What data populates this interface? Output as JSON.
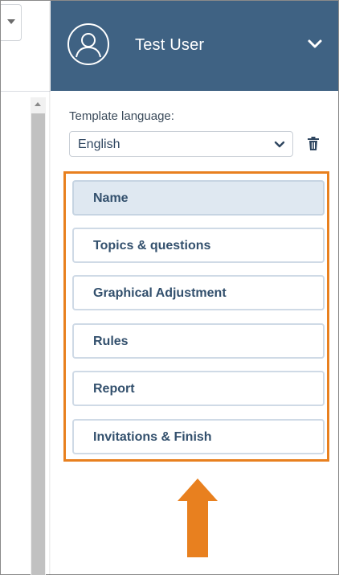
{
  "user": {
    "name": "Test User"
  },
  "template": {
    "language_label": "Template language:",
    "language_value": "English"
  },
  "steps": [
    {
      "label": "Name",
      "active": true
    },
    {
      "label": "Topics & questions",
      "active": false
    },
    {
      "label": "Graphical Adjustment",
      "active": false
    },
    {
      "label": "Rules",
      "active": false
    },
    {
      "label": "Report",
      "active": false
    },
    {
      "label": "Invitations & Finish",
      "active": false
    }
  ],
  "icons": {
    "avatar": "user-avatar-icon",
    "expand": "chevron-down-icon",
    "select_arrow": "chevron-down-icon",
    "delete": "trash-icon",
    "annotation": "arrow-up-icon"
  },
  "colors": {
    "header_bg": "#3f6283",
    "highlight": "#e8801f",
    "active_step_bg": "#dfe8f1"
  }
}
